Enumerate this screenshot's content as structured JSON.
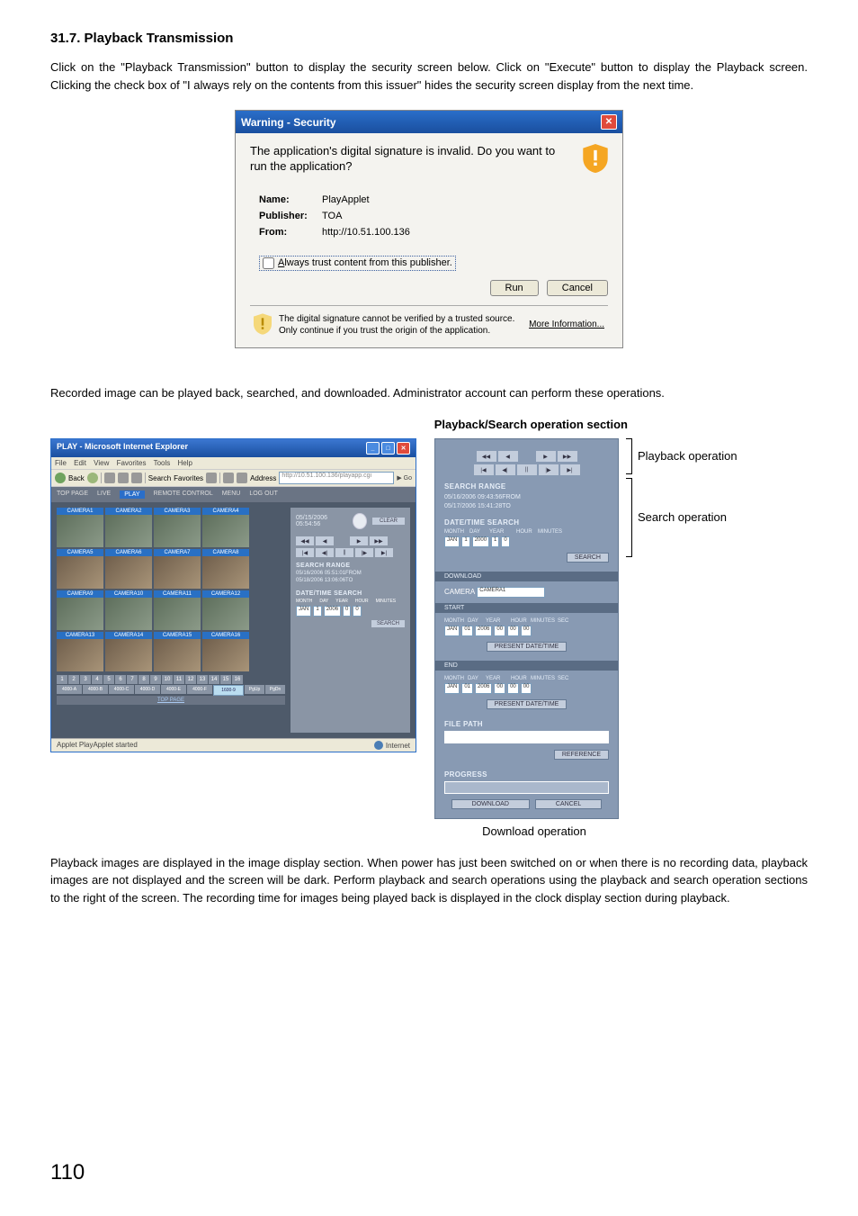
{
  "section": {
    "title": "31.7. Playback Transmission",
    "intro": "Click on the \"Playback Transmission\" button to display the security screen below. Click on \"Execute\" button to display the Playback screen. Clicking the check box of \"I always rely on the contents from this issuer\" hides the security screen display from the next time.",
    "recorded_text": "Recorded image can be played back, searched, and downloaded. Administrator account can perform these operations.",
    "playback_footer_text": "Playback images are displayed in the image display section. When power has just been switched on or when there is no recording data, playback images are not displayed and the screen will be dark. Perform playback and search operations using the playback and search operation sections to the right of the screen. The recording time for images being played back is displayed in the clock display section during playback."
  },
  "warning": {
    "title": "Warning - Security",
    "prompt": "The application's digital signature is invalid.  Do you want to run the application?",
    "name_label": "Name:",
    "name_value": "PlayApplet",
    "publisher_label": "Publisher:",
    "publisher_value": "TOA",
    "from_label": "From:",
    "from_value": "http://10.51.100.136",
    "checkbox_prefix": "A",
    "checkbox_rest": "lways trust content from this publisher.",
    "run_btn": "Run",
    "cancel_btn": "Cancel",
    "footer_text": "The digital signature cannot be verified by a trusted source.  Only continue if you trust the origin of the application.",
    "more_info": "More Information..."
  },
  "playwin": {
    "title": "PLAY - Microsoft Internet Explorer",
    "menu": {
      "file": "File",
      "edit": "Edit",
      "view": "View",
      "favorites": "Favorites",
      "tools": "Tools",
      "help": "Help"
    },
    "toolbar": {
      "back": "Back",
      "search": "Search",
      "favorites": "Favorites",
      "address_label": "Address",
      "address_value": "http://10.51.100.136/playapp.cgi",
      "go": "Go"
    },
    "tabs": {
      "top": "TOP PAGE",
      "live": "LIVE",
      "play": "PLAY",
      "remote": "REMOTE CONTROL",
      "menu": "MENU",
      "logout": "LOG OUT"
    },
    "cams": {
      "c1": "CAMERA1",
      "c2": "CAMERA2",
      "c3": "CAMERA3",
      "c4": "CAMERA4",
      "c5": "CAMERA5",
      "c6": "CAMERA6",
      "c7": "CAMERA7",
      "c8": "CAMERA8",
      "c9": "CAMERA9",
      "c10": "CAMERA10",
      "c11": "CAMERA11",
      "c12": "CAMERA12",
      "c13": "CAMERA13",
      "c14": "CAMERA14",
      "c15": "CAMERA15",
      "c16": "CAMERA16"
    },
    "nums": [
      "1",
      "2",
      "3",
      "4",
      "5",
      "6",
      "7",
      "8",
      "9",
      "10",
      "11",
      "12",
      "13",
      "14",
      "15",
      "16"
    ],
    "models": [
      "4000-A",
      "4000-B",
      "4000-C",
      "4000-D",
      "4000-E",
      "4000-F",
      "1600-9"
    ],
    "models_trailing": [
      "PgUp",
      "PgDn"
    ],
    "toppage_link": "TOP PAGE",
    "side": {
      "clock": "05/15/2006 05:54:56",
      "clear": "CLEAR",
      "search_range_title": "SEARCH RANGE",
      "search_range_from": "05/16/2006 05:51:01FROM",
      "search_range_to": "05/18/2006 13:06:06TO",
      "datetime_search_title": "DATE/TIME SEARCH",
      "labels": {
        "month": "MONTH",
        "day": "DAY",
        "year": "YEAR",
        "hour": "HOUR",
        "minutes": "MINUTES"
      },
      "month_val": "JAN",
      "day_val": "1",
      "year_val": "2006",
      "hour_val": "0",
      "min_val": "0",
      "search_btn": "SEARCH"
    },
    "status_left": "Applet PlayApplet started",
    "status_right": "Internet"
  },
  "ops": {
    "heading": "Playback/Search operation section",
    "playback_label": "Playback operation",
    "search_label": "Search operation",
    "download_label": "Download operation",
    "search_range_title": "SEARCH RANGE",
    "search_range_from": "05/16/2006 09:43:56FROM",
    "search_range_to": "05/17/2006 15:41:28TO",
    "datetime_search_title": "DATE/TIME SEARCH",
    "labels": {
      "month": "MONTH",
      "day": "DAY",
      "year": "YEAR",
      "hour": "HOUR",
      "minutes": "MINUTES",
      "sec": "SEC"
    },
    "month_val": "JAN",
    "day_val": "1",
    "year_val": "2000",
    "hour_val": "1",
    "min_val": "0",
    "search_btn": "SEARCH",
    "download_title": "DOWNLOAD",
    "camera_label": "CAMERA",
    "camera_val": "CAMERA1",
    "start_title": "START",
    "end_title": "END",
    "start_month": "JAN",
    "start_day": "01",
    "start_year": "2006",
    "start_hour": "00",
    "start_min": "00",
    "start_sec": "00",
    "end_month": "JAN",
    "end_day": "01",
    "end_year": "2006",
    "end_hour": "00",
    "end_min": "00",
    "end_sec": "00",
    "present_btn": "PRESENT DATE/TIME",
    "filepath_title": "FILE PATH",
    "reference_btn": "REFERENCE",
    "progress_title": "PROGRESS",
    "download_btn": "DOWNLOAD",
    "cancel_btn": "CANCEL"
  },
  "page_number": "110"
}
